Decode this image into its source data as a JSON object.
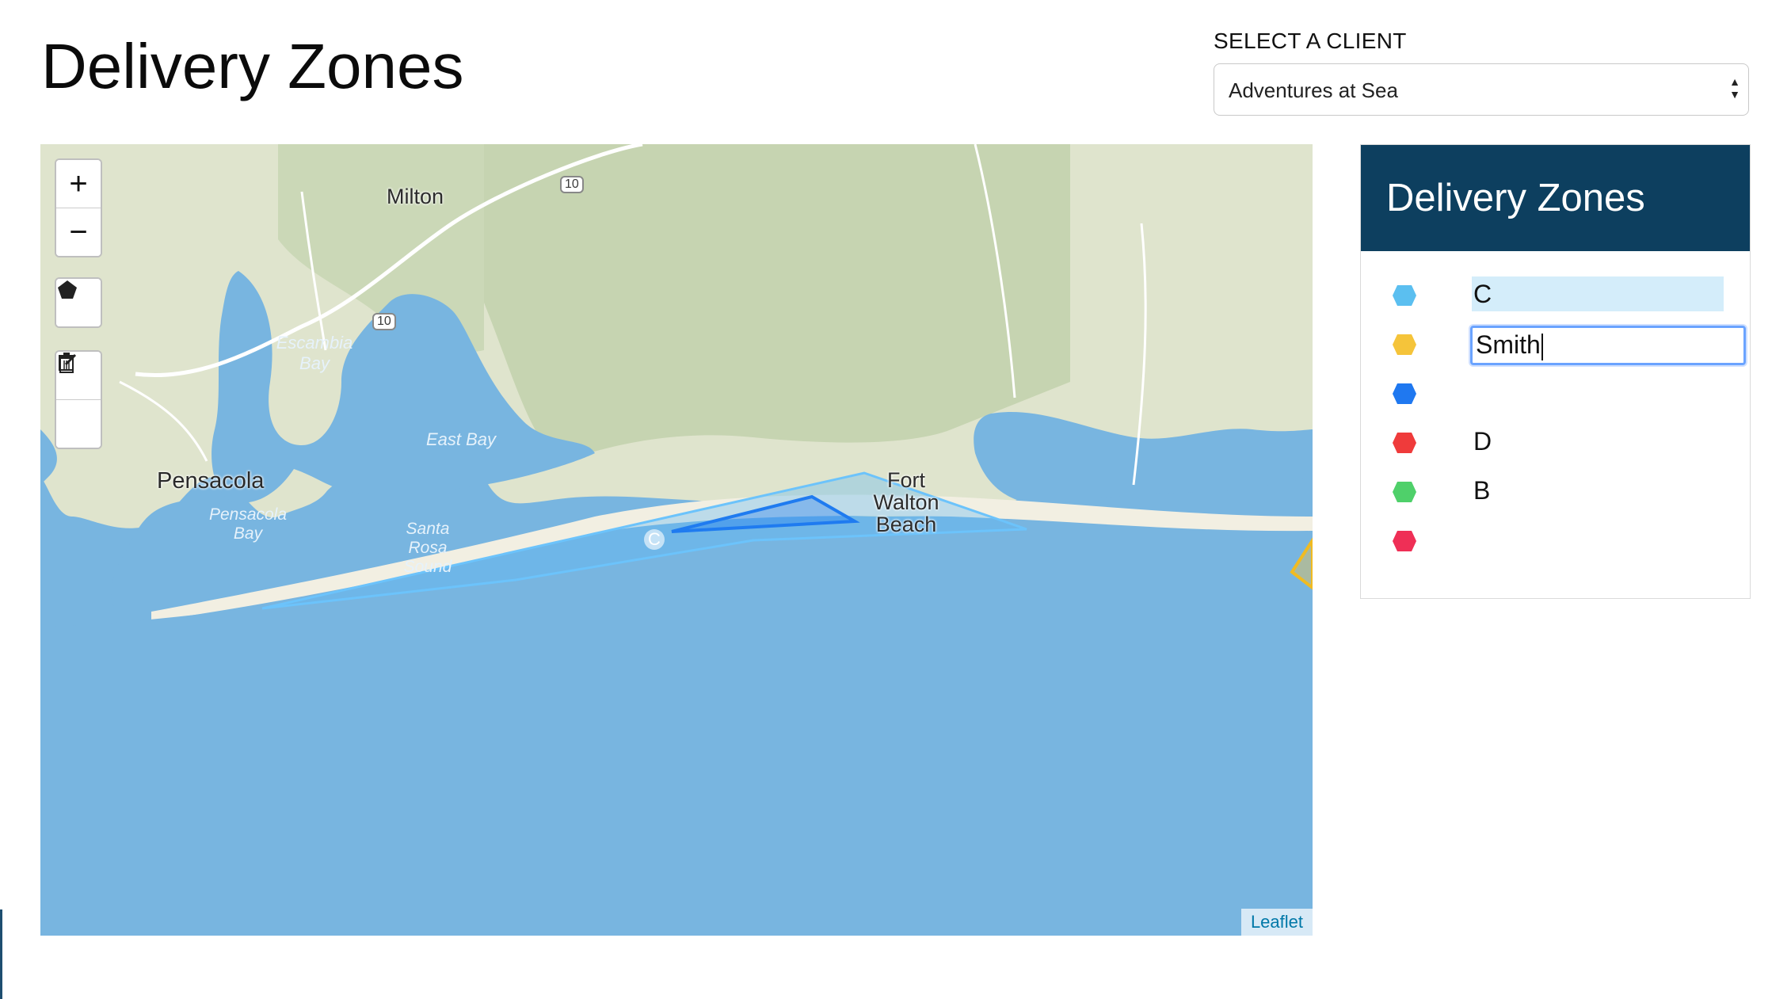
{
  "page": {
    "title": "Delivery Zones"
  },
  "client": {
    "label": "SELECT A CLIENT",
    "selected": "Adventures at Sea"
  },
  "map": {
    "labels": {
      "milton": "Milton",
      "pensacola": "Pensacola",
      "escambia_bay": "Escambia Bay",
      "east_bay": "East Bay",
      "pensacola_bay": "Pensacola Bay",
      "santa_rosa_sound": "Santa Rosa Sound",
      "fort_walton_beach": "Fort Walton Beach",
      "highway_10": "10"
    },
    "controls": {
      "zoom_in": "+",
      "zoom_out": "−"
    },
    "marker_label": "C",
    "attribution": "Leaflet",
    "colors": {
      "water": "#78b5e0",
      "land": "#dde3cc",
      "forest": "#c4d3b0",
      "zone_light": "#5bb8f5",
      "zone_dark": "#1f7bf0",
      "zone_yellow": "#f5c243"
    }
  },
  "panel": {
    "title": "Delivery Zones",
    "zones": [
      {
        "name": "C",
        "color": "#5bbff0",
        "icon": "pentagon-icon",
        "state": "highlighted"
      },
      {
        "name": "Smith",
        "color": "#f5c43a",
        "icon": "pentagon-icon",
        "state": "editing"
      },
      {
        "name": "",
        "color": "#1f78f0",
        "icon": "pentagon-icon",
        "state": "normal"
      },
      {
        "name": "D",
        "color": "#ef3b3b",
        "icon": "pentagon-icon",
        "state": "normal"
      },
      {
        "name": "B",
        "color": "#4fd06a",
        "icon": "pentagon-icon",
        "state": "normal"
      },
      {
        "name": "",
        "color": "#ef2f56",
        "icon": "pentagon-icon",
        "state": "normal"
      }
    ]
  }
}
